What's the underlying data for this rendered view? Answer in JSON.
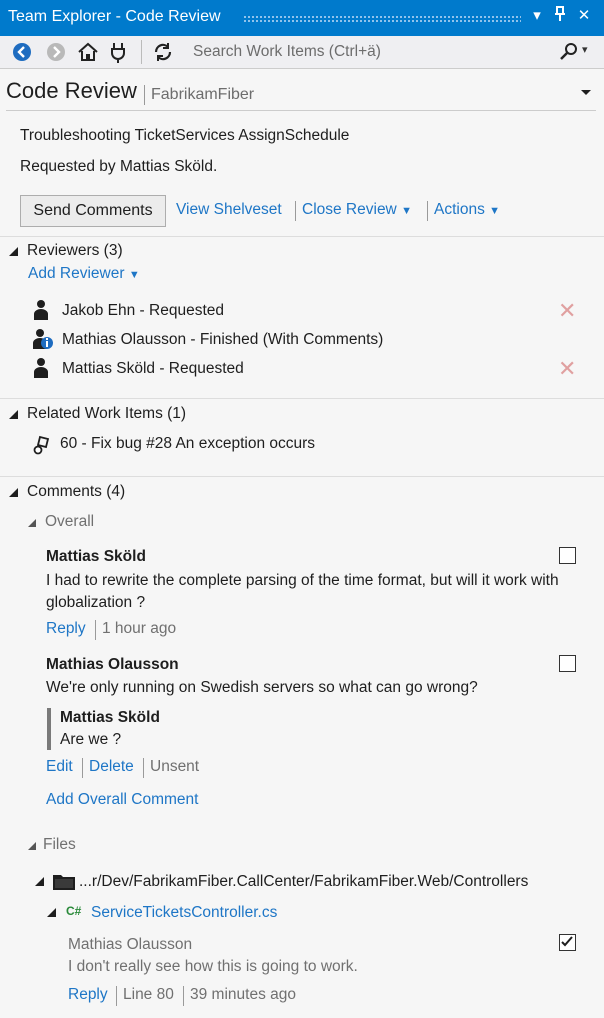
{
  "window": {
    "title": "Team Explorer - Code Review",
    "dropdown_icon": "▾",
    "pin_icon": "pin",
    "close_icon": "✕"
  },
  "toolbar": {
    "search_placeholder": "Search Work Items (Ctrl+ä)"
  },
  "header": {
    "title": "Code Review",
    "project": "FabrikamFiber"
  },
  "review": {
    "name": "Troubleshooting TicketServices AssignSchedule",
    "requested_by": "Requested by Mattias Sköld.",
    "send_comments": "Send Comments",
    "view_shelveset": "View Shelveset",
    "close_review": "Close Review",
    "actions": "Actions"
  },
  "reviewers": {
    "heading": "Reviewers (3)",
    "add_reviewer": "Add Reviewer",
    "items": [
      {
        "label": "Jakob Ehn - Requested"
      },
      {
        "label": "Mathias Olausson - Finished (With Comments)"
      },
      {
        "label": "Mattias Sköld - Requested"
      }
    ]
  },
  "work_items": {
    "heading": "Related Work Items (1)",
    "items": [
      {
        "label": "60 - Fix bug #28 An exception occurs"
      }
    ]
  },
  "comments": {
    "heading": "Comments (4)",
    "overall_label": "Overall",
    "thread1": {
      "author": "Mattias Sköld",
      "text": "I had to rewrite the complete parsing of the time format, but will it work with globalization ?",
      "reply": "Reply",
      "time": "1 hour ago"
    },
    "thread2": {
      "author": "Mathias Olausson",
      "text": "We're only running on Swedish servers so what can go wrong?",
      "reply_author": "Mattias Sköld",
      "reply_text": "Are we ?",
      "edit": "Edit",
      "delete": "Delete",
      "status": "Unsent"
    },
    "add_overall": "Add Overall Comment"
  },
  "files": {
    "label": "Files",
    "folder_path": "...r/Dev/FabrikamFiber.CallCenter/FabrikamFiber.Web/Controllers",
    "file_badge": "C#",
    "file_name": "ServiceTicketsController.cs",
    "comment": {
      "author": "Mathias Olausson",
      "text": "I don't really see how this is going to work.",
      "reply": "Reply",
      "line": "Line 80",
      "time": "39 minutes ago"
    }
  },
  "colors": {
    "accent": "#007acc",
    "link": "#1e76c6",
    "background": "#f6f6f6"
  }
}
